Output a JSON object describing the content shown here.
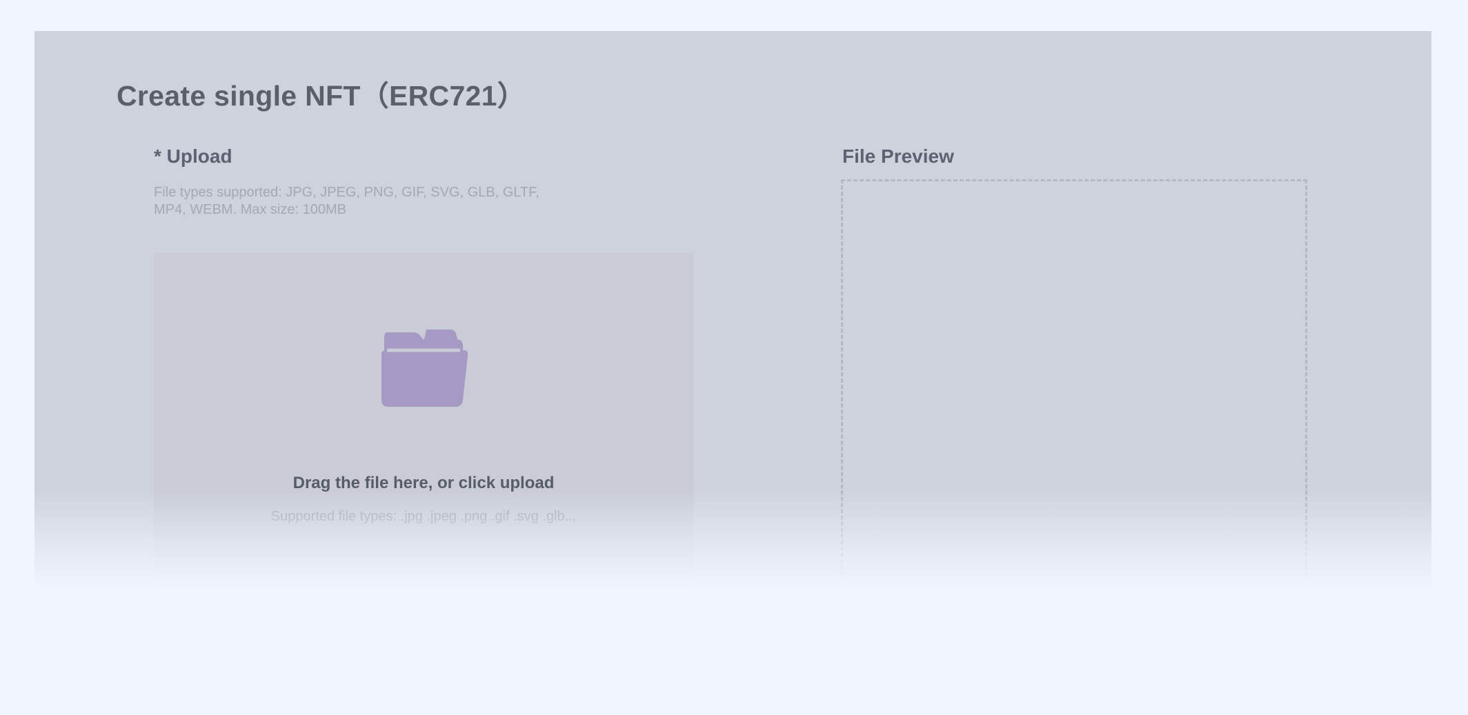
{
  "page": {
    "title": "Create single NFT（ERC721）"
  },
  "upload": {
    "label": "* Upload",
    "hint": "File types supported: JPG, JPEG, PNG, GIF, SVG, GLB, GLTF, MP4, WEBM. Max size: 100MB",
    "dropzone": {
      "icon": "folder-icon",
      "title": "Drag the file here, or click upload",
      "subtitle": "Supported file types: .jpg .jpeg .png .gif .svg .glb..."
    }
  },
  "preview": {
    "label": "File Preview"
  },
  "colors": {
    "background": "#f0f5ff",
    "card": "#ced2dc",
    "folder_icon": "#a69ac4",
    "heading_text": "#5b5f6a",
    "muted_text": "#a4a8b3"
  }
}
